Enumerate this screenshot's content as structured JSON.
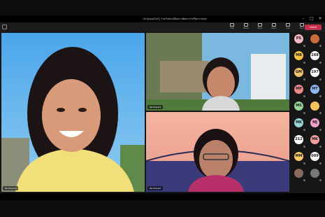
{
  "window": {
    "title": "ประชุมออนไลน์ | ร่วมกันขับเคลื่อนการพัฒนาการเรียนการสอน",
    "controls": [
      "–",
      "□",
      "✕"
    ]
  },
  "toolbar": {
    "items": [
      {
        "label": "Chat",
        "icon": "chat-icon"
      },
      {
        "label": "People",
        "icon": "people-icon"
      },
      {
        "label": "Raise",
        "icon": "hand-icon"
      },
      {
        "label": "React",
        "icon": "react-icon"
      },
      {
        "label": "View",
        "icon": "view-icon"
      },
      {
        "label": "More",
        "icon": "more-icon"
      },
      {
        "label": "Camera",
        "icon": "camera-icon"
      },
      {
        "label": "Mic",
        "icon": "mic-icon"
      },
      {
        "label": "Share",
        "icon": "share-icon"
      }
    ],
    "leave_label": "Leave"
  },
  "participants_video": [
    {
      "name": "Participant",
      "bg": "#5aa8e8"
    },
    {
      "name": "Participant",
      "bg": "#7fb9e0"
    },
    {
      "name": "Participant",
      "bg": "#e9a19f"
    }
  ],
  "roster": [
    {
      "initials": "PS",
      "color": "#f2b8c6",
      "name": ""
    },
    {
      "initials": "",
      "color": "#c96b3a",
      "name": ""
    },
    {
      "initials": "MB",
      "color": "#f4c542",
      "name": ""
    },
    {
      "initials": "288",
      "color": "#ffffff",
      "name": ""
    },
    {
      "initials": "GM",
      "color": "#f0c26a",
      "name": ""
    },
    {
      "initials": "197",
      "color": "#ffffff",
      "name": ""
    },
    {
      "initials": "MP",
      "color": "#f08a8a",
      "name": ""
    },
    {
      "initials": "MT",
      "color": "#8fb7f0",
      "name": ""
    },
    {
      "initials": "MS",
      "color": "#9ad39a",
      "name": ""
    },
    {
      "initials": "",
      "color": "#f6c25b",
      "name": ""
    },
    {
      "initials": "MK",
      "color": "#9ad6d6",
      "name": ""
    },
    {
      "initials": "MJ",
      "color": "#f0a0c8",
      "name": ""
    },
    {
      "initials": "212",
      "color": "#ffffff",
      "name": ""
    },
    {
      "initials": "MK",
      "color": "#f4a0a0",
      "name": ""
    },
    {
      "initials": "MM",
      "color": "#f7c86a",
      "name": ""
    },
    {
      "initials": "009",
      "color": "#ffffff",
      "name": ""
    },
    {
      "initials": "",
      "color": "#8a6a5a",
      "name": ""
    },
    {
      "initials": "",
      "color": "#777777",
      "name": ""
    }
  ],
  "colors": {
    "leave": "#c4314b",
    "background": "#0d0d0d"
  }
}
